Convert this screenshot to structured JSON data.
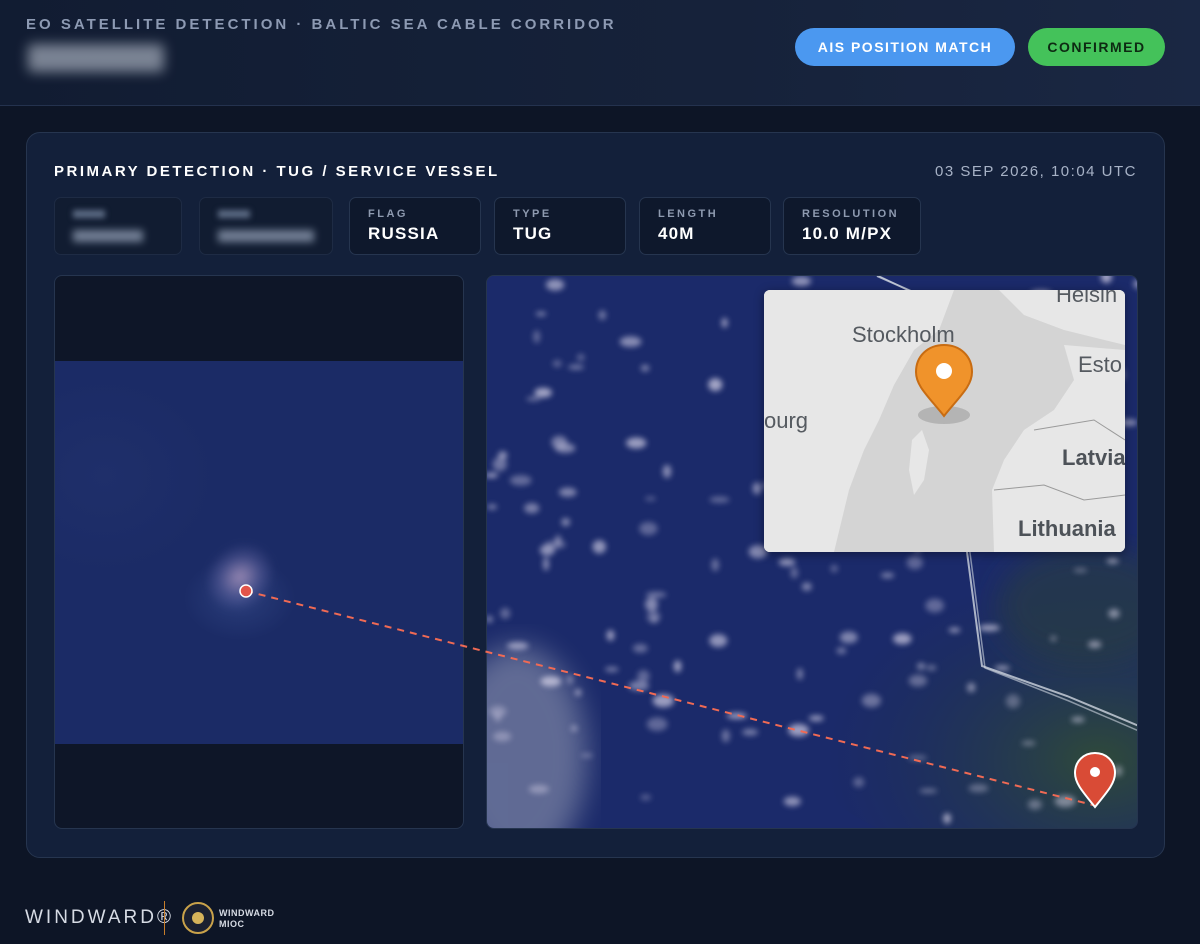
{
  "header": {
    "title": "EO SATELLITE DETECTION · BALTIC SEA CABLE CORRIDOR",
    "ais_label": "AIS POSITION MATCH",
    "status_label": "CONFIRMED"
  },
  "detection": {
    "title": "PRIMARY DETECTION · TUG / SERVICE VESSEL",
    "datetime": "03 SEP 2026, 10:04 UTC",
    "stats": [
      {
        "label": "FLAG",
        "value": "RUSSIA"
      },
      {
        "label": "TYPE",
        "value": "TUG"
      },
      {
        "label": "LENGTH",
        "value": "40M"
      },
      {
        "label": "RESOLUTION",
        "value": "10.0 M/PX"
      }
    ]
  },
  "locator_map": {
    "labels": {
      "stockholm": "Stockholm",
      "helsinki_partial": "Helsin",
      "estonia_partial": "Esto",
      "gothenburg_partial": "ourg",
      "latvia": "Latvia",
      "lithuania": "Lithuania"
    },
    "marker_color": "#f0932b"
  },
  "colors": {
    "ais_pill": "#4b98f0",
    "confirmed_pill": "#44c25a",
    "connector_line": "#f06a54",
    "location_pin": "#d94b36"
  },
  "footer": {
    "brand": "WINDWARD®",
    "sub_line1": "WINDWARD",
    "sub_line2": "MIOC"
  }
}
